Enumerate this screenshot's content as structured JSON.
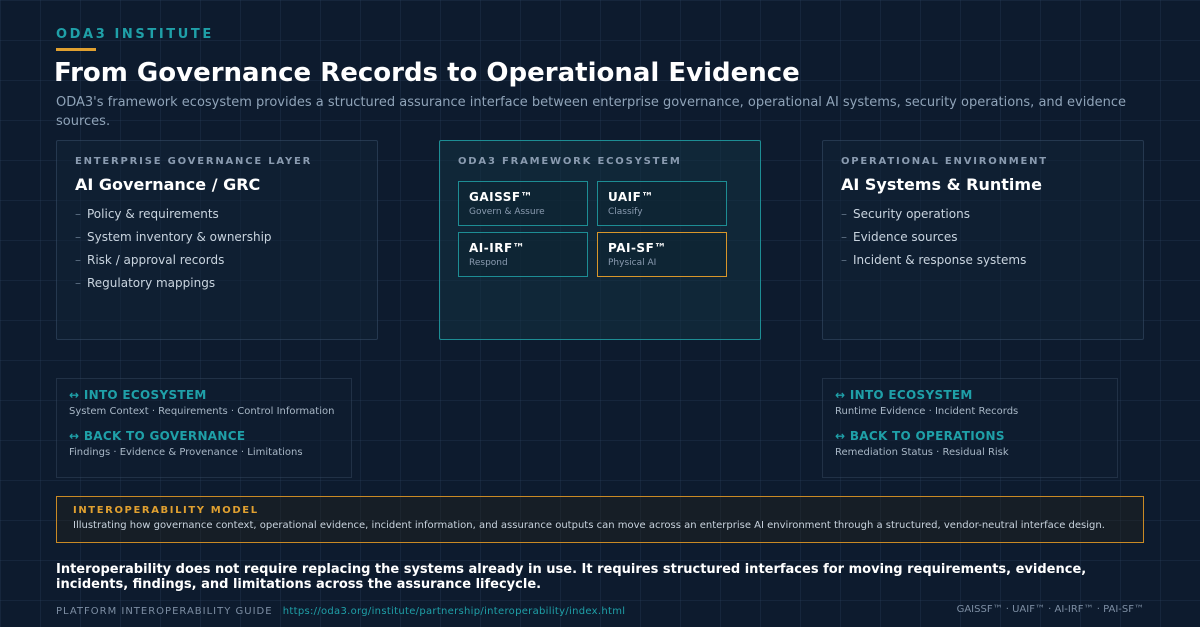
{
  "header": {
    "eyebrow": "ODA3 INSTITUTE",
    "title": "From Governance Records to Operational Evidence",
    "subtitle": "ODA3's framework ecosystem provides a structured assurance interface between enterprise governance, operational AI systems, security operations, and evidence sources."
  },
  "left_panel": {
    "label": "ENTERPRISE GOVERNANCE LAYER",
    "heading": "AI Governance / GRC",
    "items": [
      "Policy & requirements",
      "System inventory & ownership",
      "Risk / approval records",
      "Regulatory mappings"
    ]
  },
  "center_panel": {
    "label": "ODA3 FRAMEWORK ECOSYSTEM",
    "frameworks": [
      {
        "name": "GAISSF™",
        "sub": "Govern & Assure"
      },
      {
        "name": "UAIF™",
        "sub": "Classify"
      },
      {
        "name": "AI-IRF™",
        "sub": "Respond"
      },
      {
        "name": "PAI-SF™",
        "sub": "Physical AI"
      }
    ]
  },
  "right_panel": {
    "label": "OPERATIONAL ENVIRONMENT",
    "heading": "AI Systems & Runtime",
    "items": [
      "Security operations",
      "Evidence sources",
      "Incident & response systems"
    ]
  },
  "flows_left": {
    "into_head": "↔ INTO ECOSYSTEM",
    "into_text": "System Context · Requirements · Control Information",
    "back_head": "↔ BACK TO GOVERNANCE",
    "back_text": "Findings · Evidence & Provenance · Limitations"
  },
  "flows_right": {
    "into_head": "↔ INTO ECOSYSTEM",
    "into_text": "Runtime Evidence · Incident Records",
    "back_head": "↔ BACK TO OPERATIONS",
    "back_text": "Remediation Status · Residual Risk"
  },
  "interop": {
    "label": "INTEROPERABILITY MODEL",
    "text": "Illustrating how governance context, operational evidence, incident information, and assurance outputs can move across an enterprise AI environment through a structured, vendor-neutral interface design."
  },
  "statement": "Interoperability does not require replacing the systems already in use. It requires structured interfaces for moving requirements, evidence, incidents, findings, and limitations across the assurance lifecycle.",
  "footer": {
    "guide_label": "PLATFORM INTEROPERABILITY GUIDE",
    "link": "https://oda3.org/institute/partnership/interoperability/index.html",
    "trademarks": "GAISSF™ · UAIF™ · AI-IRF™ · PAI-SF™"
  },
  "colors": {
    "background": "#0d1b2e",
    "teal_accent": "#1fa0a8",
    "amber_accent": "#e0a030"
  }
}
